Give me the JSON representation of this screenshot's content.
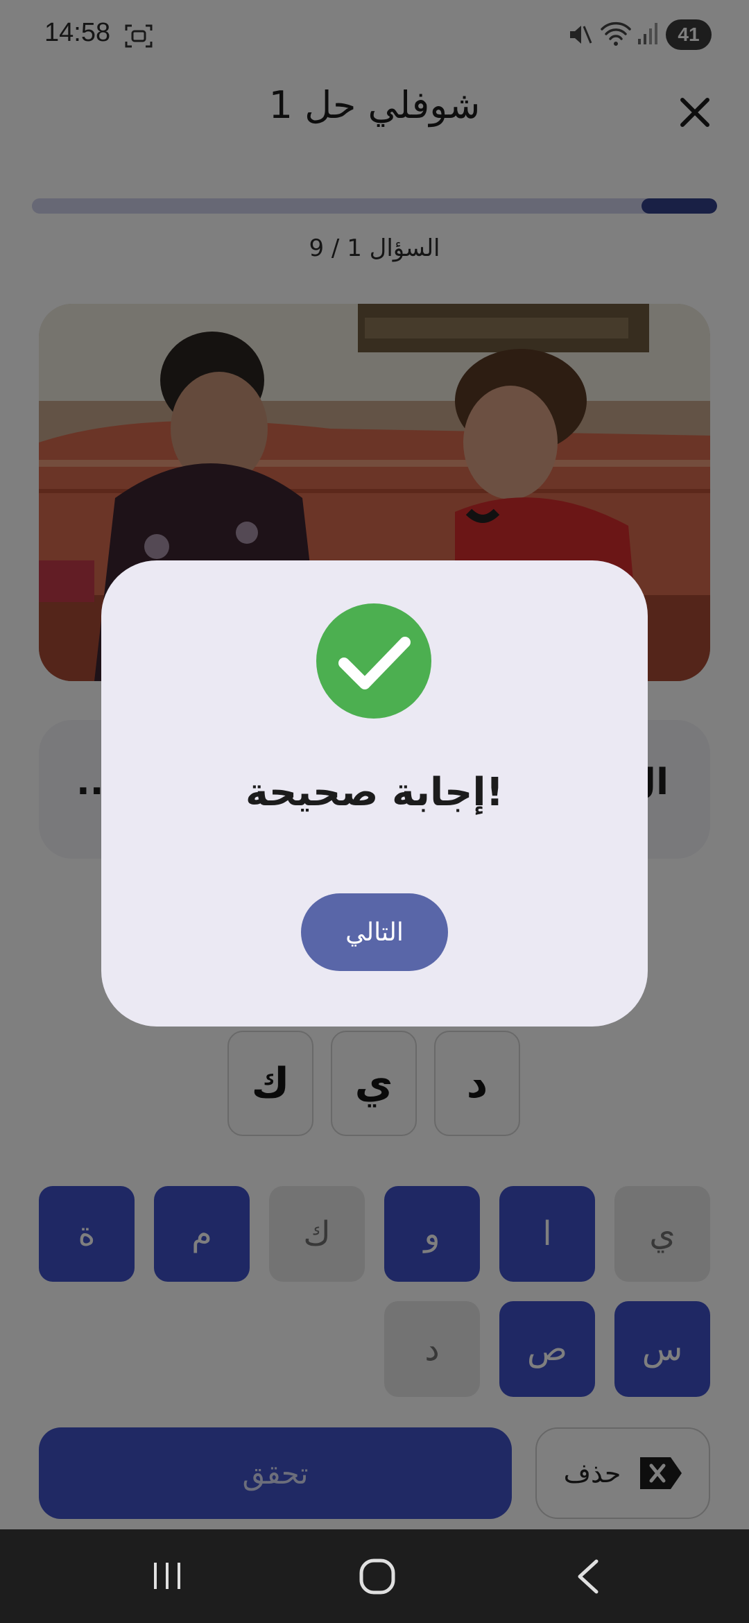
{
  "status_bar": {
    "time": "14:58",
    "battery": "41"
  },
  "header": {
    "title": "شوفلي حل 1"
  },
  "progress": {
    "fraction": 0.11,
    "counter_text": "السؤال 1 / 9"
  },
  "clue": {
    "right_text": "ال",
    "left_text": ".."
  },
  "answer_slots": [
    "ك",
    "ي",
    "د"
  ],
  "keyboard": {
    "row1": [
      {
        "letter": "ة",
        "state": "active"
      },
      {
        "letter": "م",
        "state": "active"
      },
      {
        "letter": "ك",
        "state": "used"
      },
      {
        "letter": "و",
        "state": "active"
      },
      {
        "letter": "ا",
        "state": "active"
      },
      {
        "letter": "ي",
        "state": "used"
      }
    ],
    "row2": [
      {
        "letter": "د",
        "state": "used"
      },
      {
        "letter": "ص",
        "state": "active"
      },
      {
        "letter": "س",
        "state": "active"
      }
    ]
  },
  "actions": {
    "check_label": "تحقق",
    "delete_label": "حذف"
  },
  "dialog": {
    "title": "إجابة صحيحة!",
    "next_label": "التالي"
  },
  "colors": {
    "primary": "#3f51c8",
    "success": "#4caf50",
    "dialog_bg": "#ebe9f3",
    "next_button": "#5966a8"
  }
}
